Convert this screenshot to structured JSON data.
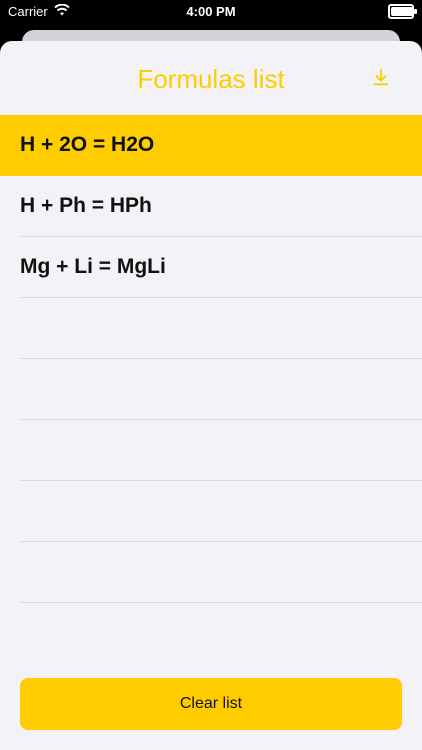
{
  "status": {
    "carrier": "Carrier",
    "time": "4:00 PM"
  },
  "sheet": {
    "title": "Formulas list"
  },
  "formulas": [
    {
      "text": "H + 2O = H2O",
      "selected": true
    },
    {
      "text": "H + Ph = HPh",
      "selected": false
    },
    {
      "text": "Mg + Li = MgLi",
      "selected": false
    },
    {
      "text": "",
      "selected": false
    },
    {
      "text": "",
      "selected": false
    },
    {
      "text": "",
      "selected": false
    },
    {
      "text": "",
      "selected": false
    },
    {
      "text": "",
      "selected": false
    }
  ],
  "actions": {
    "clear_label": "Clear list"
  },
  "colors": {
    "accent": "#ffcc00",
    "background": "#f2f2f7"
  },
  "icons": {
    "download": "download-icon",
    "wifi": "wifi-icon",
    "battery": "battery-icon"
  }
}
